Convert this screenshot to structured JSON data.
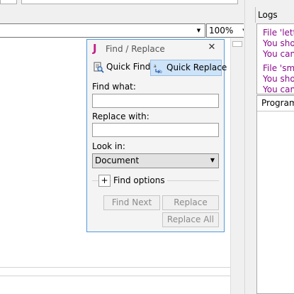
{
  "toolbar": {
    "zoom_value": "100%"
  },
  "logs": {
    "title": "Logs",
    "lines": [
      "File 'lette",
      "You sho",
      "You can",
      "File 'smi",
      "You sho",
      "You can"
    ],
    "program_tab": "Program"
  },
  "dialog": {
    "logo": "J",
    "title": "Find / Replace",
    "close_glyph": "✕",
    "tabs": {
      "quick_find": "Quick Find",
      "quick_replace": "Quick Replace"
    },
    "find_what_label": "Find what:",
    "find_what_value": "",
    "replace_with_label": "Replace with:",
    "replace_with_value": "",
    "look_in_label": "Look in:",
    "look_in_value": "Document",
    "find_options_label": "Find options",
    "buttons": {
      "find_next": "Find Next",
      "replace": "Replace",
      "replace_all": "Replace All"
    }
  },
  "colors": {
    "log_text": "#8b0a8b",
    "dialog_border": "#4d9be0",
    "logo": "#c31b85",
    "selected_tab": "#cde3f7"
  }
}
